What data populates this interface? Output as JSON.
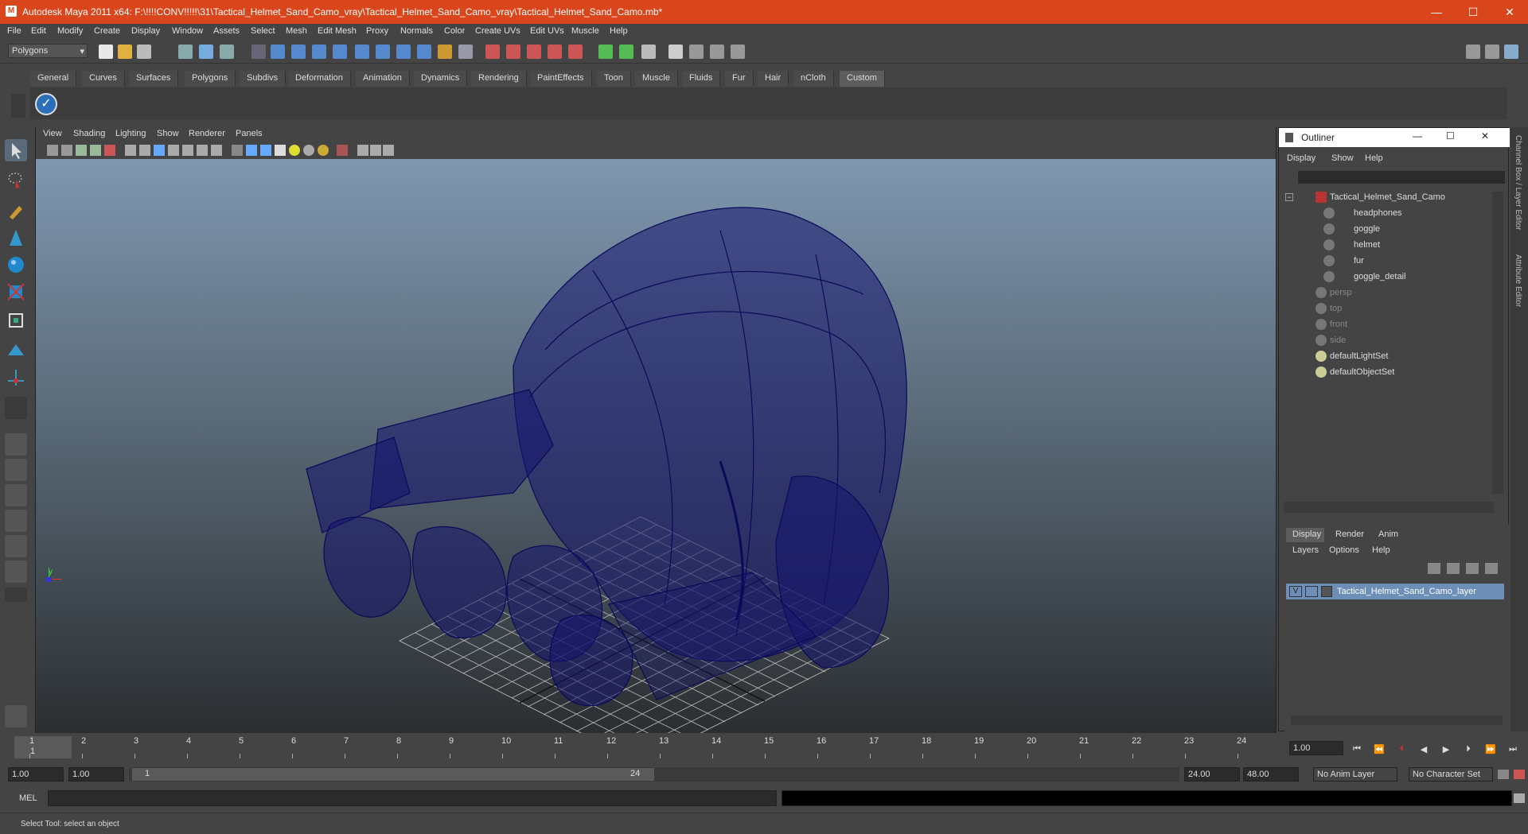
{
  "window": {
    "title": "Autodesk Maya 2011 x64: F:\\!!!!CONV!!!!!\\31\\Tactical_Helmet_Sand_Camo_vray\\Tactical_Helmet_Sand_Camo_vray\\Tactical_Helmet_Sand_Camo.mb*",
    "minimize": "—",
    "maximize": "☐",
    "close": "✕"
  },
  "menu": [
    "File",
    "Edit",
    "Modify",
    "Create",
    "Display",
    "Window",
    "Assets",
    "Select",
    "Mesh",
    "Edit Mesh",
    "Proxy",
    "Normals",
    "Color",
    "Create UVs",
    "Edit UVs",
    "Muscle",
    "Help"
  ],
  "status": {
    "mode": "Polygons"
  },
  "shelf_tabs": [
    "General",
    "Curves",
    "Surfaces",
    "Polygons",
    "Subdivs",
    "Deformation",
    "Animation",
    "Dynamics",
    "Rendering",
    "PaintEffects",
    "Toon",
    "Muscle",
    "Fluids",
    "Fur",
    "Hair",
    "nCloth",
    "Custom"
  ],
  "shelf_active": "Custom",
  "viewport": {
    "menu": [
      "View",
      "Shading",
      "Lighting",
      "Show",
      "Renderer",
      "Panels"
    ],
    "axis_y": "y",
    "axis_x": "x",
    "accent": "#0a0a5a"
  },
  "outliner": {
    "title": "Outliner",
    "menu": [
      "Display",
      "Show",
      "Help"
    ],
    "items": [
      {
        "label": "Tactical_Helmet_Sand_Camo",
        "icon": "group-icon",
        "dim": false,
        "indent": 0
      },
      {
        "label": "headphones",
        "icon": "mesh-icon",
        "dim": false,
        "indent": 1
      },
      {
        "label": "goggle",
        "icon": "mesh-icon",
        "dim": false,
        "indent": 1
      },
      {
        "label": "helmet",
        "icon": "mesh-icon",
        "dim": false,
        "indent": 1
      },
      {
        "label": "fur",
        "icon": "mesh-icon",
        "dim": false,
        "indent": 1
      },
      {
        "label": "goggle_detail",
        "icon": "mesh-icon",
        "dim": false,
        "indent": 1
      },
      {
        "label": "persp",
        "icon": "camera-icon",
        "dim": true,
        "indent": 0
      },
      {
        "label": "top",
        "icon": "camera-icon",
        "dim": true,
        "indent": 0
      },
      {
        "label": "front",
        "icon": "camera-icon",
        "dim": true,
        "indent": 0
      },
      {
        "label": "side",
        "icon": "camera-icon",
        "dim": true,
        "indent": 0
      },
      {
        "label": "defaultLightSet",
        "icon": "set-icon",
        "dim": false,
        "indent": 0
      },
      {
        "label": "defaultObjectSet",
        "icon": "set-icon",
        "dim": false,
        "indent": 0
      }
    ]
  },
  "layer_editor": {
    "tabs": [
      "Display",
      "Render",
      "Anim"
    ],
    "menu": [
      "Layers",
      "Options",
      "Help"
    ],
    "layer": {
      "visible": "V",
      "name": "Tactical_Helmet_Sand_Camo_layer"
    }
  },
  "right_strip": {
    "channel_box": "Channel Box / Layer Editor",
    "attribute_editor": "Attribute Editor"
  },
  "timeline": {
    "ticks": [
      "1",
      "2",
      "3",
      "4",
      "5",
      "6",
      "7",
      "8",
      "9",
      "10",
      "11",
      "12",
      "13",
      "14",
      "15",
      "16",
      "17",
      "18",
      "19",
      "20",
      "21",
      "22",
      "23",
      "24"
    ],
    "current_frame": "1",
    "current_field": "1.00"
  },
  "range": {
    "start": "1.00",
    "playback_start": "1.00",
    "slider_start": "1",
    "slider_end": "24",
    "playback_end": "24.00",
    "end": "48.00",
    "anim_layer": "No Anim Layer",
    "character_set": "No Character Set"
  },
  "mel": {
    "label": "MEL"
  },
  "help_line": "Select Tool: select an object"
}
